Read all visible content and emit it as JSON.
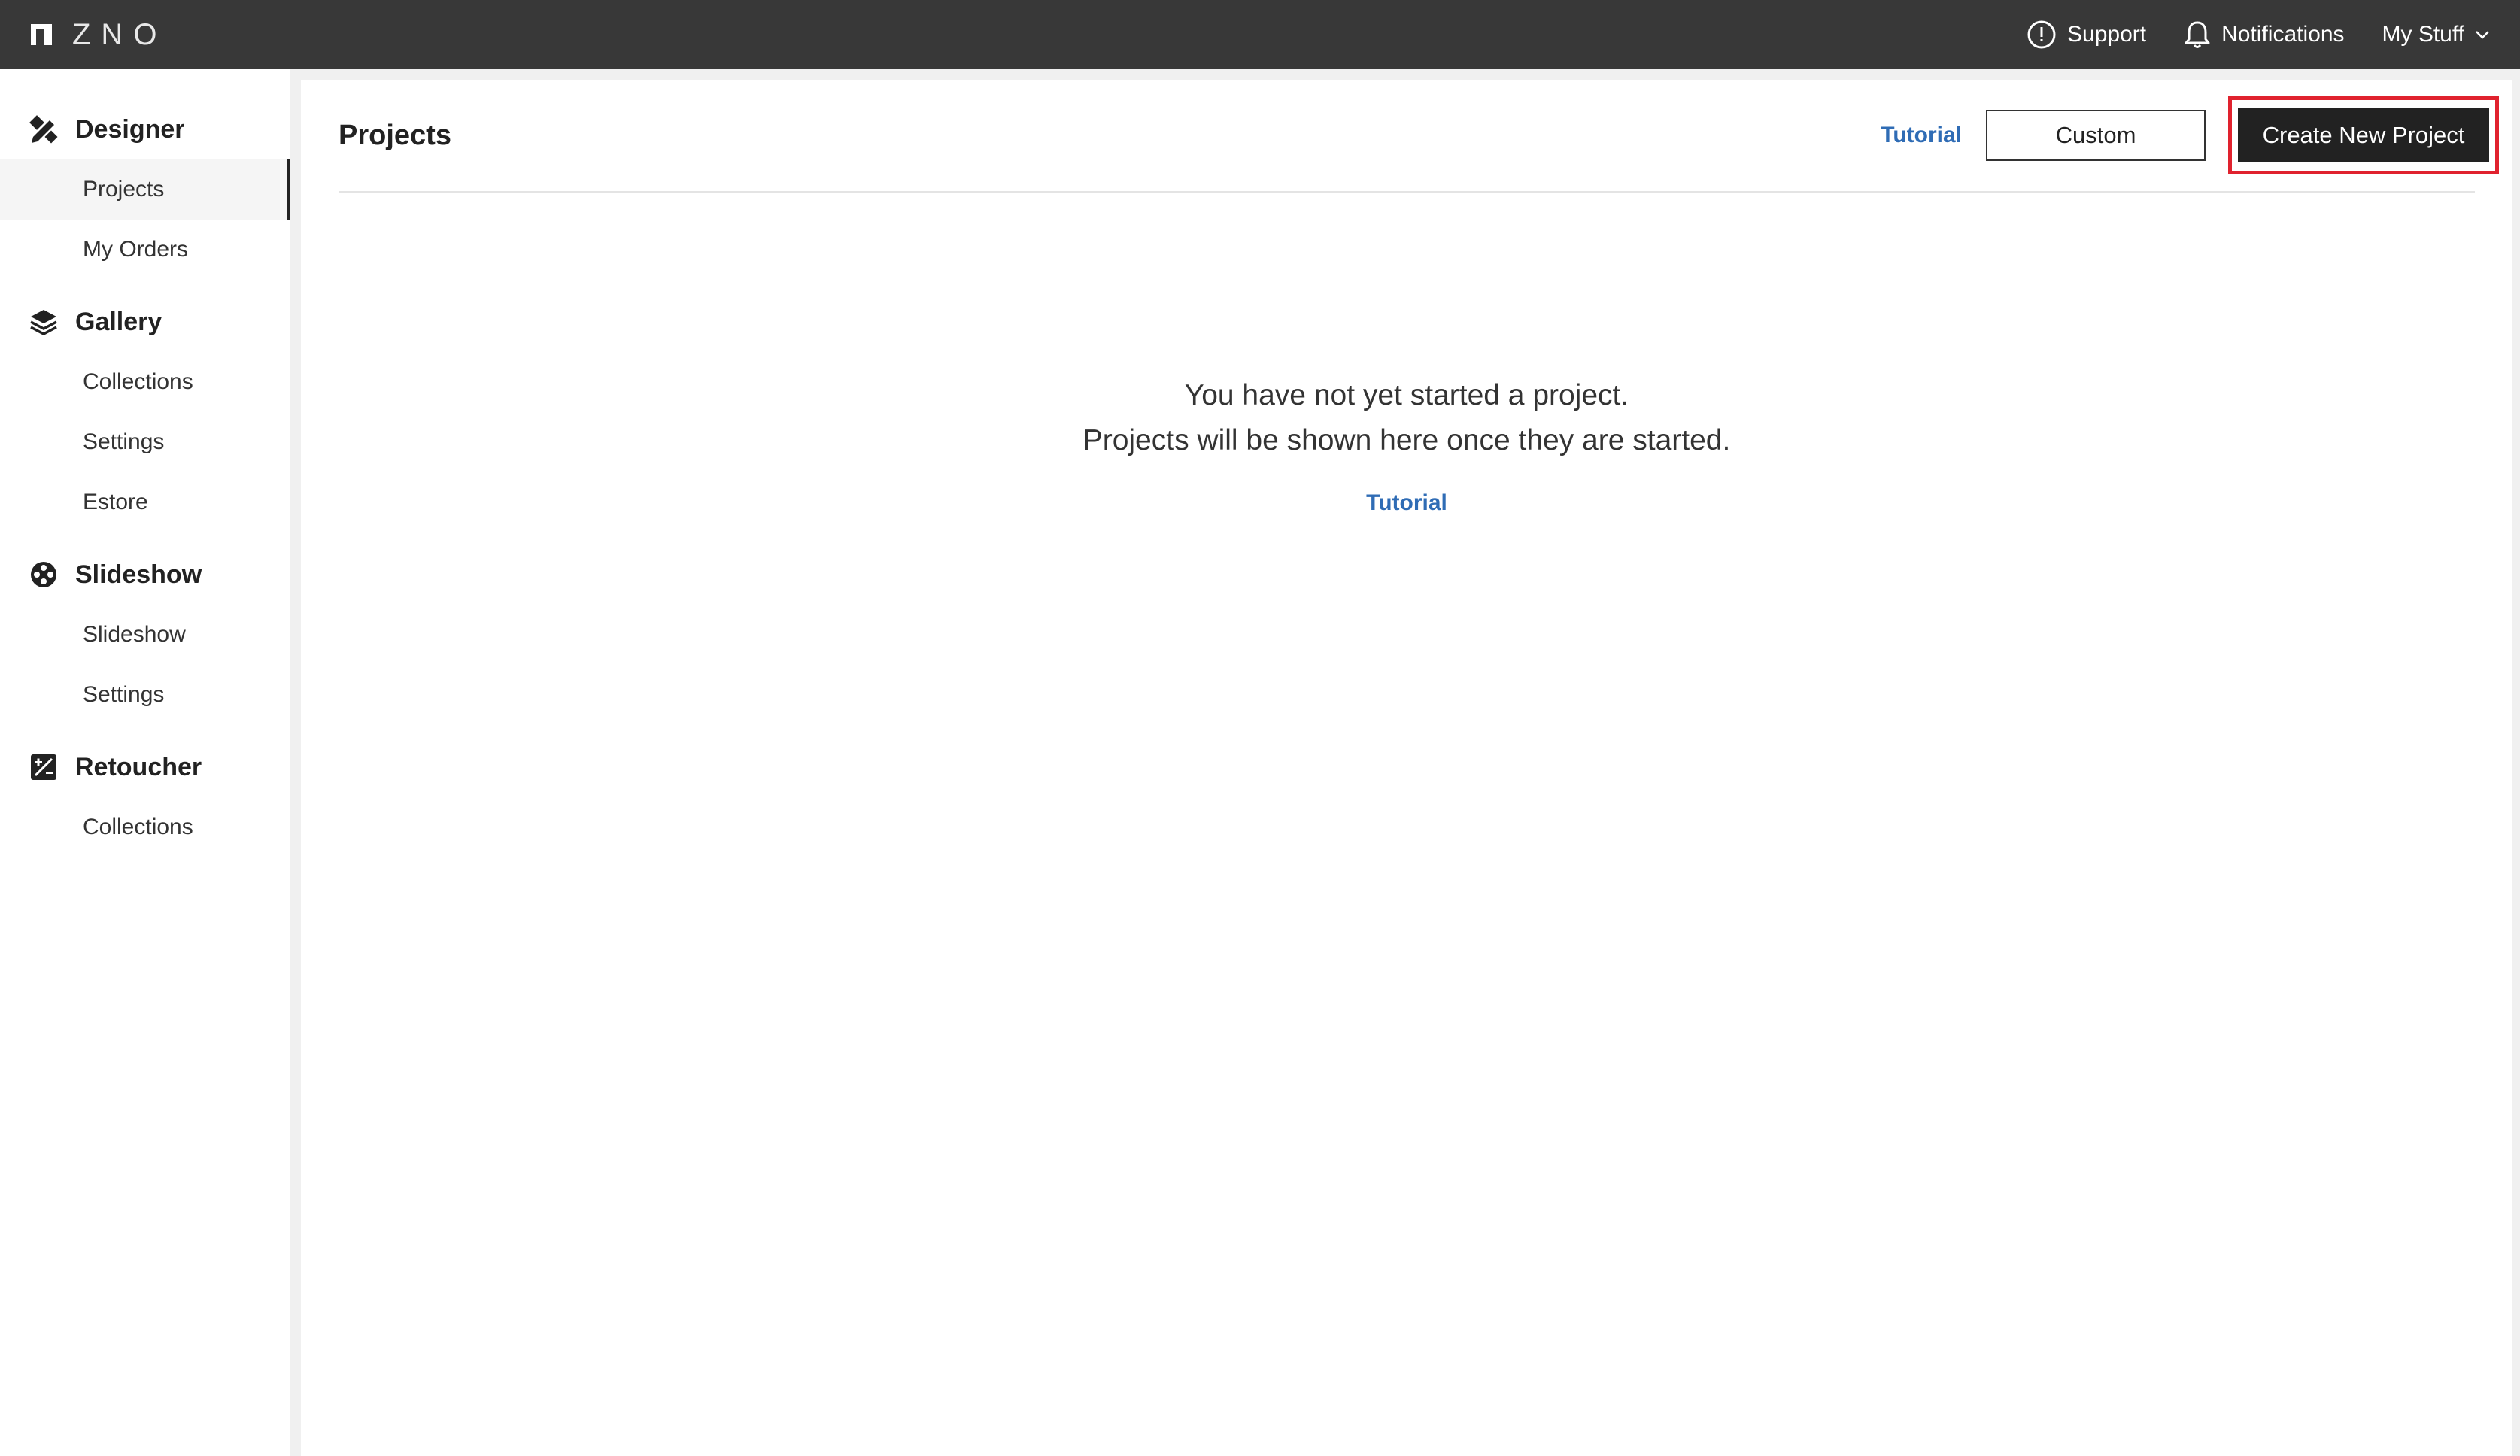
{
  "topbar": {
    "logo_text": "ZNO",
    "support_label": "Support",
    "notifications_label": "Notifications",
    "mystuff_label": "My Stuff"
  },
  "sidebar": {
    "sections": [
      {
        "title": "Designer",
        "icon": "designer-icon",
        "items": [
          "Projects",
          "My Orders"
        ]
      },
      {
        "title": "Gallery",
        "icon": "layers-icon",
        "items": [
          "Collections",
          "Settings",
          "Estore"
        ]
      },
      {
        "title": "Slideshow",
        "icon": "film-reel-icon",
        "items": [
          "Slideshow",
          "Settings"
        ]
      },
      {
        "title": "Retoucher",
        "icon": "retouch-icon",
        "items": [
          "Collections"
        ]
      }
    ],
    "active_item": "Projects"
  },
  "main": {
    "title": "Projects",
    "tutorial_link": "Tutorial",
    "custom_button": "Custom",
    "create_button": "Create New Project",
    "empty_line1": "You have not yet started a project.",
    "empty_line2": "Projects will be shown here once they are started.",
    "empty_tutorial": "Tutorial"
  },
  "colors": {
    "topbar": "#383838",
    "link": "#2f6cb5",
    "highlight": "#e0222e"
  }
}
